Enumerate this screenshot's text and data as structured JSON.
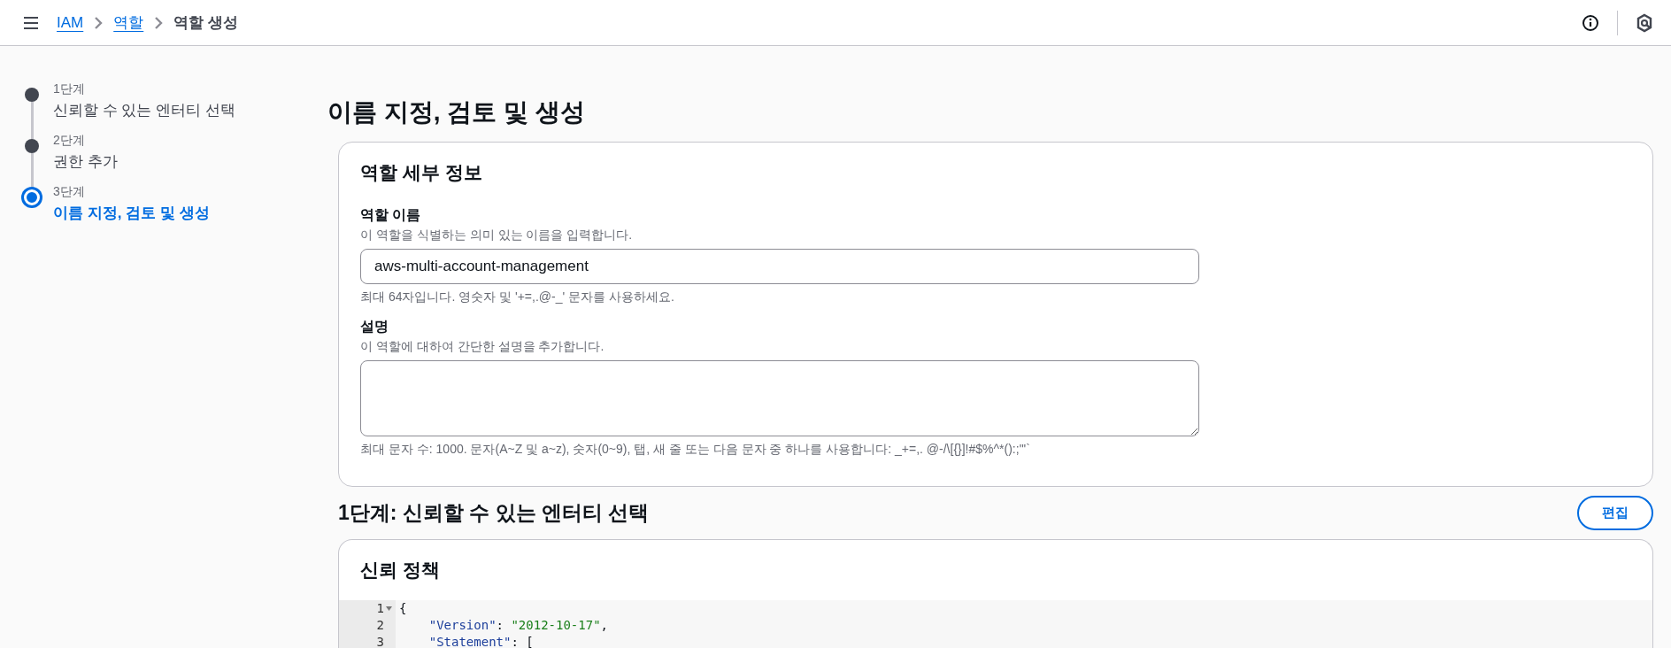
{
  "breadcrumbs": [
    {
      "label": "IAM",
      "link": true
    },
    {
      "label": "역할",
      "link": true
    },
    {
      "label": "역할 생성",
      "link": false
    }
  ],
  "steps": [
    {
      "step": "1단계",
      "title": "신뢰할 수 있는 엔터티 선택",
      "selected": false
    },
    {
      "step": "2단계",
      "title": "권한 추가",
      "selected": false
    },
    {
      "step": "3단계",
      "title": "이름 지정, 검토 및 생성",
      "selected": true
    }
  ],
  "page_title": "이름 지정, 검토 및 생성",
  "details": {
    "title": "역할 세부 정보",
    "fields": [
      {
        "kind": "input",
        "label": "역할 이름",
        "description": "이 역할을 식별하는 의미 있는 이름을 입력합니다.",
        "value": "aws-multi-account-management",
        "constraint": "최대 64자입니다. 영숫자 및 '+=,.@-_' 문자를 사용하세요."
      },
      {
        "kind": "textarea",
        "label": "설명",
        "description": "이 역할에 대하여 간단한 설명을 추가합니다.",
        "constraint": "최대 문자 수: 1000. 문자(A~Z 및 a~z), 숫자(0~9), 탭, 새 줄 또는 다음 문자 중 하나를 사용합니다: _+=,. @-/\\[{}]!#$%^*():;\"'`"
      }
    ]
  },
  "step1": {
    "title": "1단계: 신뢰할 수 있는 엔터티 선택",
    "edit_button": "편집",
    "policy_title": "신뢰 정책",
    "code": [
      {
        "number": "1",
        "text": "{",
        "foldable": true
      },
      {
        "number": "2",
        "text": "    \"Version\": \"2012-10-17\",",
        "foldable": false
      },
      {
        "number": "3",
        "text": "    \"Statement\": [",
        "foldable": false
      }
    ]
  }
}
